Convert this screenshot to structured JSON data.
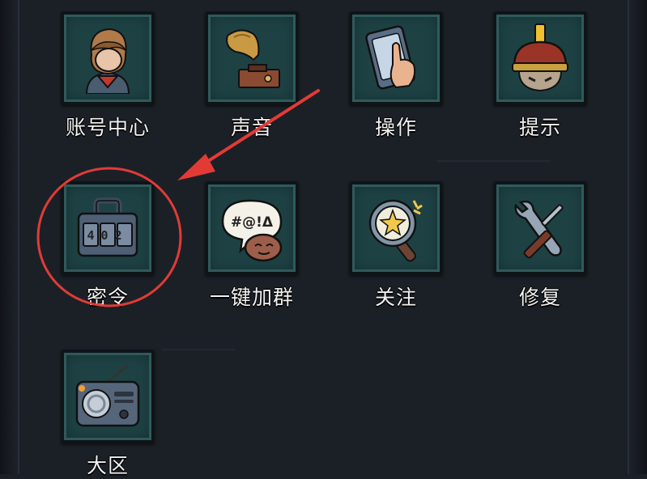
{
  "menu": {
    "items": [
      {
        "label": "账号中心",
        "icon": "account-avatar-icon"
      },
      {
        "label": "声音",
        "icon": "gramophone-icon"
      },
      {
        "label": "操作",
        "icon": "touch-phone-icon"
      },
      {
        "label": "提示",
        "icon": "helmet-warrior-icon"
      },
      {
        "label": "密令",
        "icon": "code-lock-icon"
      },
      {
        "label": "一键加群",
        "icon": "chat-bubble-icon"
      },
      {
        "label": "关注",
        "icon": "magnifier-star-icon"
      },
      {
        "label": "修复",
        "icon": "wrench-screwdriver-icon"
      },
      {
        "label": "大区",
        "icon": "radio-icon"
      }
    ],
    "lock_digits": "402",
    "chat_symbols": "#@!Δ"
  },
  "annotation": {
    "highlight_color": "#e23b36",
    "target": "密令"
  }
}
